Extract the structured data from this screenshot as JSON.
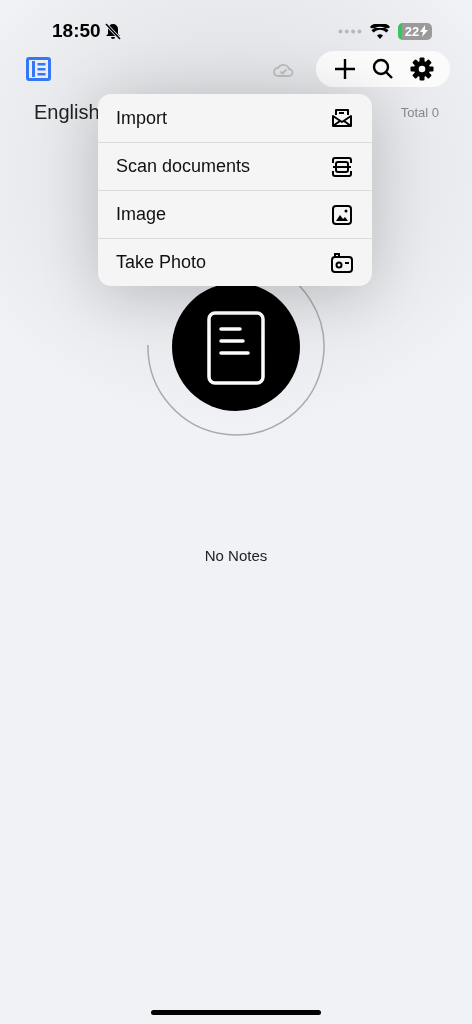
{
  "status_bar": {
    "time": "18:50",
    "silent": true,
    "battery": "22",
    "charging": true
  },
  "toolbar": {
    "synced": true
  },
  "header": {
    "title": "English",
    "total": "Total 0"
  },
  "menu": {
    "items": [
      {
        "label": "Import",
        "kind": "import"
      },
      {
        "label": "Scan documents",
        "kind": "scan"
      },
      {
        "label": "Image",
        "kind": "image"
      },
      {
        "label": "Take Photo",
        "kind": "camera"
      }
    ]
  },
  "empty_state": {
    "message": "No Notes"
  }
}
